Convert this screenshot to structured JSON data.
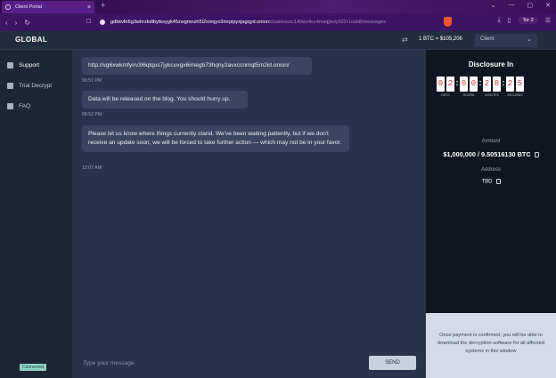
{
  "browser": {
    "tab_title": "Client Portal",
    "tab_close": "×",
    "new_tab": "+",
    "url_host": "gdbkvfe6g3whrzkdlbytksygk45zwgmnzh5i2xmqyo3mrpipysjagqyd.onion",
    "url_path": "/chat/xvcnc140wv4cc4msqjbvly922r1osh8/messages",
    "tor_label": "Tor 2",
    "nav_back": "‹",
    "nav_forward": "›",
    "nav_reload": "↻",
    "bookmark_icon": "bookmark-icon",
    "window_controls": [
      "⌄",
      "—",
      "▢",
      "✕"
    ],
    "toolbar_icons": [
      "⤓",
      "▯",
      "☰"
    ]
  },
  "header": {
    "logo": "GLOBAL",
    "rate": "1 BTC = $105,206",
    "rate_icon": "⇄",
    "client_select": "Client",
    "chevron": "⌄"
  },
  "sidebar": {
    "items": [
      {
        "label": "Support",
        "icon": "chat-icon",
        "active": true
      },
      {
        "label": "Trial Decrypt",
        "icon": "unlock-icon",
        "active": false
      },
      {
        "label": "FAQ",
        "icon": "book-icon",
        "active": false
      }
    ],
    "status": "Connected"
  },
  "chat": {
    "messages": [
      {
        "text": "http://vg6xwkmfyirv3l6qlqus7jykcuvgx6imegb73hqny2avxccnmqt5m2id.onion/",
        "time": "06:51 PM"
      },
      {
        "text": "Data will be released on the blog. You should hurry up.",
        "time": "06:52 PM"
      },
      {
        "text": "Please let us know where things currently stand. We've been waiting patiently, but if we don't receive an update soon, we will be forced to take further action — which may not be in your favor.",
        "time": "12:07 AM"
      }
    ],
    "input_placeholder": "Type your message",
    "send_label": "SEND"
  },
  "disclosure": {
    "title": "Disclosure In",
    "countdown": {
      "days": [
        "0",
        "2"
      ],
      "hours": [
        "0",
        "0"
      ],
      "minutes": [
        "2",
        "8"
      ],
      "seconds": [
        "2",
        "5"
      ],
      "labels": [
        "DAYS",
        "HOURS",
        "MINUTES",
        "SECONDS"
      ]
    },
    "amount_label": "Amount",
    "amount": "$1,000,000 / 9.50516130 BTC",
    "address_label": "Address",
    "address": "TBD",
    "notice": "Once payment is confirmed, you will be able to download the decryption software for all affected systems in this window"
  },
  "colors": {
    "accent_purple": "#3d1463",
    "digit_red": "#d23b3b",
    "connected_badge": "#8fd2c6"
  }
}
